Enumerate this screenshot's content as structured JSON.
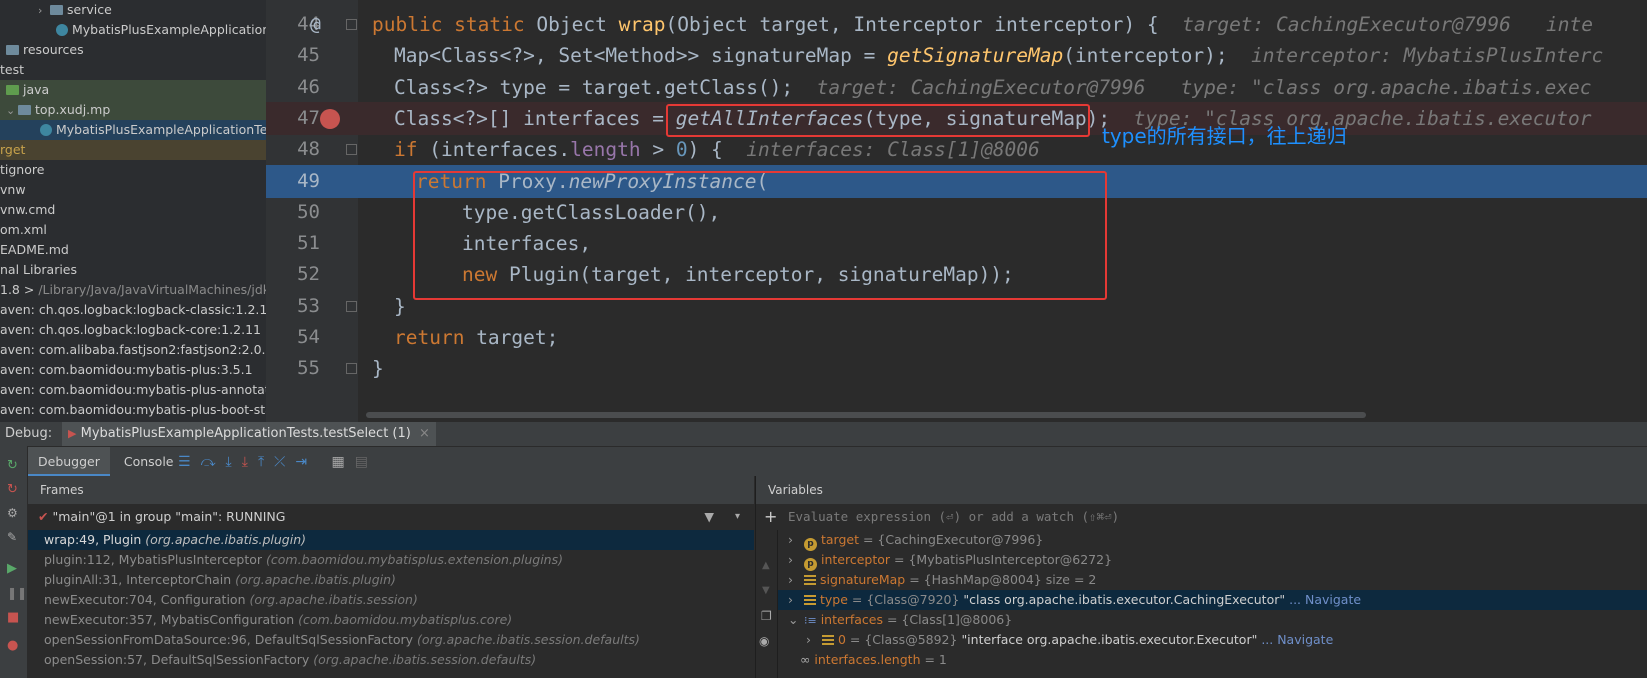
{
  "project_tree": [
    {
      "label": "service",
      "indent": 38,
      "arrow": "›",
      "icon": "folder"
    },
    {
      "label": "MybatisPlusExampleApplication",
      "indent": 56,
      "arrow": "",
      "icon": "class"
    },
    {
      "label": "resources",
      "indent": 6,
      "arrow": "",
      "icon": "folder"
    },
    {
      "label": "test",
      "indent": 0,
      "arrow": "",
      "icon": ""
    },
    {
      "label": "java",
      "indent": 6,
      "arrow": "",
      "icon": "folder-green",
      "hl": "green"
    },
    {
      "label": "top.xudj.mp",
      "indent": 6,
      "arrow": "⌄",
      "icon": "folder",
      "hl": "green"
    },
    {
      "label": "MybatisPlusExampleApplicationTes",
      "indent": 40,
      "arrow": "",
      "icon": "class",
      "hl": "blue"
    },
    {
      "label": "rget",
      "indent": 0,
      "arrow": "",
      "icon": "",
      "hl": "orange"
    },
    {
      "label": "tignore",
      "indent": 0,
      "arrow": "",
      "icon": ""
    },
    {
      "label": "vnw",
      "indent": 0,
      "arrow": "",
      "icon": ""
    },
    {
      "label": "vnw.cmd",
      "indent": 0,
      "arrow": "",
      "icon": ""
    },
    {
      "label": "om.xml",
      "indent": 0,
      "arrow": "",
      "icon": ""
    },
    {
      "label": "EADME.md",
      "indent": 0,
      "arrow": "",
      "icon": ""
    },
    {
      "label": "nal Libraries",
      "indent": 0,
      "arrow": "",
      "icon": ""
    },
    {
      "label": "1.8 >",
      "indent": 0,
      "arrow": "",
      "icon": "",
      "grey": "/Library/Java/JavaVirtualMachines/jdk1"
    },
    {
      "label": "aven: ch.qos.logback:logback-classic:1.2.11",
      "indent": 0,
      "arrow": "",
      "icon": ""
    },
    {
      "label": "aven: ch.qos.logback:logback-core:1.2.11",
      "indent": 0,
      "arrow": "",
      "icon": ""
    },
    {
      "label": "aven: com.alibaba.fastjson2:fastjson2:2.0.23",
      "indent": 0,
      "arrow": "",
      "icon": ""
    },
    {
      "label": "aven: com.baomidou:mybatis-plus:3.5.1",
      "indent": 0,
      "arrow": "",
      "icon": ""
    },
    {
      "label": "aven: com.baomidou:mybatis-plus-annotatic",
      "indent": 0,
      "arrow": "",
      "icon": ""
    },
    {
      "label": "aven: com.baomidou:mybatis-plus-boot-sta",
      "indent": 0,
      "arrow": "",
      "icon": ""
    }
  ],
  "editor": {
    "line_numbers": [
      "44",
      "45",
      "46",
      "47",
      "48",
      "49",
      "50",
      "51",
      "52",
      "53",
      "54",
      "55"
    ],
    "l44": {
      "a": "public static ",
      "b": "Object ",
      "fn": "wrap",
      "c": "(Object target, Interceptor interceptor) {",
      "hint": "target: CachingExecutor@7996   inte"
    },
    "l45": {
      "a": "Map<Class<?>, Set<Method>> signatureMap = ",
      "fn": "getSignatureMap",
      "c": "(interceptor);",
      "hint": "interceptor: MybatisPlusInterc"
    },
    "l46": {
      "a": "Class<?> type = target.getClass();",
      "hint": "target: CachingExecutor@7996   type: \"class org.apache.ibatis.exec"
    },
    "l47": {
      "a": "Class<?>[] interfaces = ",
      "fn": "getAllInterfaces",
      "b": "(type, signatureMap);",
      "hint": "type: \"class org.apache.ibatis.executor"
    },
    "l48": {
      "kw": "if ",
      "a": "(interfaces.",
      "field": "length",
      "b": " > ",
      "num": "0",
      "c": ") {",
      "hint": "interfaces: Class[1]@8006"
    },
    "l49": {
      "kw": "return ",
      "a": "Proxy.",
      "fn": "newProxyInstance",
      "b": "("
    },
    "l50": {
      "a": "type.getClassLoader(),"
    },
    "l51": {
      "a": "interfaces,"
    },
    "l52": {
      "kw": "new ",
      "a": "Plugin(target, interceptor, signatureMap));"
    },
    "l53": {
      "a": "}"
    },
    "l54": {
      "kw": "return ",
      "a": "target;"
    },
    "l55": {
      "a": "}"
    }
  },
  "annotation_text": "type的所有接口，往上递归",
  "debug": {
    "label": "Debug:",
    "session": "MybatisPlusExampleApplicationTests.testSelect (1)",
    "tabs": [
      "Debugger",
      "Console"
    ],
    "frames_title": "Frames",
    "thread": "\"main\"@1 in group \"main\": RUNNING",
    "frames": [
      {
        "loc": "wrap:49, Plugin ",
        "pkg": "(org.apache.ibatis.plugin)"
      },
      {
        "loc": "plugin:112, MybatisPlusInterceptor ",
        "pkg": "(com.baomidou.mybatisplus.extension.plugins)"
      },
      {
        "loc": "pluginAll:31, InterceptorChain ",
        "pkg": "(org.apache.ibatis.plugin)"
      },
      {
        "loc": "newExecutor:704, Configuration ",
        "pkg": "(org.apache.ibatis.session)"
      },
      {
        "loc": "newExecutor:357, MybatisConfiguration ",
        "pkg": "(com.baomidou.mybatisplus.core)"
      },
      {
        "loc": "openSessionFromDataSource:96, DefaultSqlSessionFactory ",
        "pkg": "(org.apache.ibatis.session.defaults)"
      },
      {
        "loc": "openSession:57, DefaultSqlSessionFactory ",
        "pkg": "(org.apache.ibatis.session.defaults)"
      }
    ],
    "vars_title": "Variables",
    "eval_placeholder": "Evaluate expression (⏎) or add a watch (⇧⌘⏎)",
    "vars": [
      {
        "name": "target",
        "val": " = {CachingExecutor@7996}",
        "icon": "p",
        "indent": 0
      },
      {
        "name": "interceptor",
        "val": " = {MybatisPlusInterceptor@6272}",
        "icon": "p",
        "indent": 0
      },
      {
        "name": "signatureMap",
        "val": " = {HashMap@8004}  size = 2",
        "icon": "f",
        "indent": 0
      },
      {
        "name": "type",
        "val": " = {Class@7920} ",
        "str": "\"class org.apache.ibatis.executor.CachingExecutor\"",
        "link": " ... Navigate",
        "icon": "f",
        "indent": 0
      },
      {
        "name": "interfaces",
        "val": " = {Class[1]@8006}",
        "icon": "a",
        "indent": 0
      },
      {
        "name": "0",
        "val": " = {Class@5892} ",
        "str": "\"interface org.apache.ibatis.executor.Executor\"",
        "link": " ... Navigate",
        "icon": "f",
        "indent": 18
      },
      {
        "name": "interfaces.length",
        "val": " = 1",
        "icon": "oo",
        "indent": 0
      }
    ]
  }
}
